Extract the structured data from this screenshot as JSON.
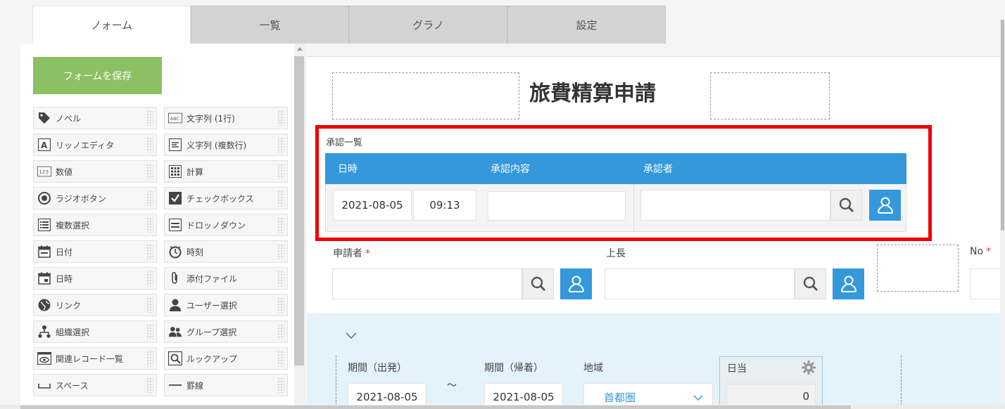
{
  "tabs": [
    {
      "label": "ノォーム"
    },
    {
      "label": "一覧"
    },
    {
      "label": "グラノ"
    },
    {
      "label": "設定"
    }
  ],
  "sidebar": {
    "save_label": "フォームを保存",
    "items": [
      {
        "label": "ノベル",
        "icon": "tag-icon"
      },
      {
        "label": "文字列 (1行)",
        "icon": "text-single-icon"
      },
      {
        "label": "リッノエディタ",
        "icon": "rich-editor-icon"
      },
      {
        "label": "义字列 (複数行)",
        "icon": "text-multi-icon"
      },
      {
        "label": "数値",
        "icon": "number-icon"
      },
      {
        "label": "計算",
        "icon": "calc-icon"
      },
      {
        "label": "ラジオボタン",
        "icon": "radio-icon"
      },
      {
        "label": "チェックボックス",
        "icon": "checkbox-icon"
      },
      {
        "label": "複数選択",
        "icon": "multiselect-icon"
      },
      {
        "label": "ドロッノダウン",
        "icon": "dropdown-icon"
      },
      {
        "label": "日付",
        "icon": "date-icon"
      },
      {
        "label": "時刻",
        "icon": "clock-icon"
      },
      {
        "label": "日時",
        "icon": "datetime-icon"
      },
      {
        "label": "添付ファイル",
        "icon": "paperclip-icon"
      },
      {
        "label": "リンク",
        "icon": "globe-icon"
      },
      {
        "label": "ユーザー選択",
        "icon": "user-icon"
      },
      {
        "label": "組織選択",
        "icon": "org-icon"
      },
      {
        "label": "グループ選択",
        "icon": "group-icon"
      },
      {
        "label": "関連レコード一覧",
        "icon": "related-records-icon"
      },
      {
        "label": "ルックアップ",
        "icon": "lookup-icon"
      },
      {
        "label": "スペース",
        "icon": "space-icon"
      },
      {
        "label": "罫線",
        "icon": "line-icon"
      }
    ]
  },
  "form": {
    "title": "旅費精算申請",
    "approval": {
      "label": "承認一覧",
      "headers": [
        "日時",
        "承認内容",
        "承認者"
      ],
      "date": "2021-08-05",
      "time": "09:13"
    },
    "applicant_label": "申請者",
    "boss_label": "上長",
    "no_label": "No",
    "period_start_label": "期間（出発）",
    "period_end_label": "期間（帰着）",
    "tilde": "〜",
    "region_label": "地域",
    "daily_label": "日当",
    "period_start_value": "2021-08-05",
    "period_end_value": "2021-08-05",
    "region_value": "首都圏",
    "daily_value": "0"
  },
  "colors": {
    "accent_blue": "#3498db",
    "save_green": "#8cc063",
    "highlight_red": "#ee0000",
    "required": "#ee3333"
  }
}
